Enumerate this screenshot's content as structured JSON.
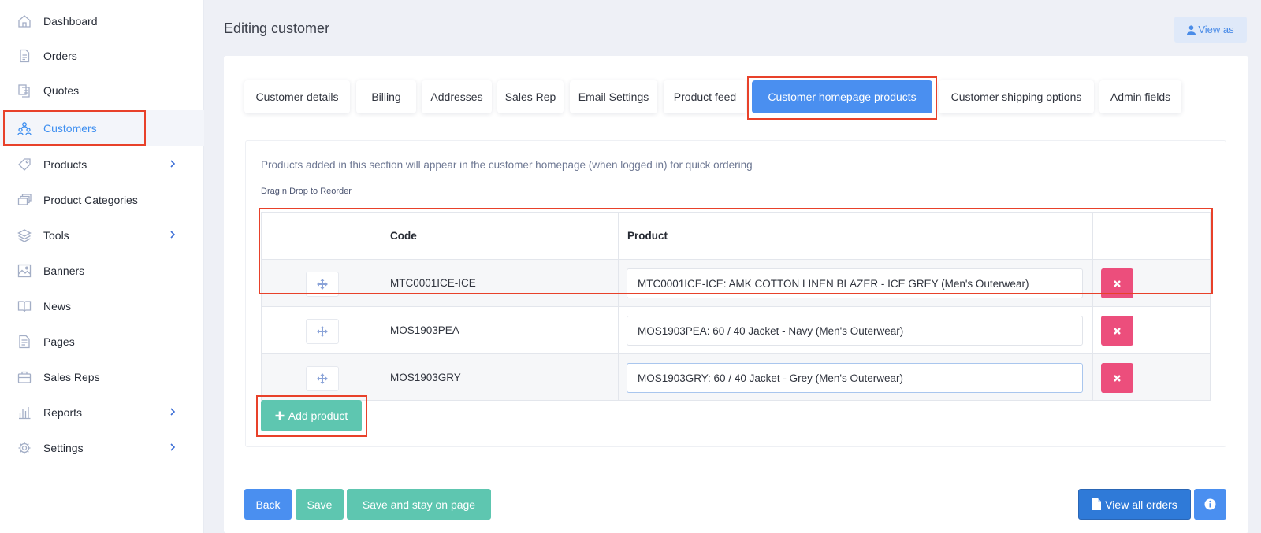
{
  "sidebar": {
    "items": [
      {
        "label": "Dashboard",
        "icon": "home-icon",
        "chevron": false,
        "active": false
      },
      {
        "label": "Orders",
        "icon": "document-icon",
        "chevron": false,
        "active": false
      },
      {
        "label": "Quotes",
        "icon": "quotes-icon",
        "chevron": false,
        "active": false
      },
      {
        "label": "Customers",
        "icon": "users-icon",
        "chevron": false,
        "active": true
      },
      {
        "label": "Products",
        "icon": "tag-icon",
        "chevron": true,
        "active": false
      },
      {
        "label": "Product Categories",
        "icon": "stack-icon",
        "chevron": false,
        "active": false
      },
      {
        "label": "Tools",
        "icon": "layers-icon",
        "chevron": true,
        "active": false
      },
      {
        "label": "Banners",
        "icon": "image-icon",
        "chevron": false,
        "active": false
      },
      {
        "label": "News",
        "icon": "book-icon",
        "chevron": false,
        "active": false
      },
      {
        "label": "Pages",
        "icon": "page-icon",
        "chevron": false,
        "active": false
      },
      {
        "label": "Sales Reps",
        "icon": "briefcase-icon",
        "chevron": false,
        "active": false
      },
      {
        "label": "Reports",
        "icon": "bar-chart-icon",
        "chevron": true,
        "active": false
      },
      {
        "label": "Settings",
        "icon": "gear-icon",
        "chevron": true,
        "active": false
      }
    ]
  },
  "header": {
    "title": "Editing customer",
    "view_as_label": "View as"
  },
  "tabs": [
    {
      "label": "Customer details",
      "active": false
    },
    {
      "label": "Billing",
      "active": false
    },
    {
      "label": "Addresses",
      "active": false
    },
    {
      "label": "Sales Rep",
      "active": false
    },
    {
      "label": "Email Settings",
      "active": false
    },
    {
      "label": "Product feed",
      "active": false
    },
    {
      "label": "Customer homepage products",
      "active": true
    },
    {
      "label": "Customer shipping options",
      "active": false
    },
    {
      "label": "Admin fields",
      "active": false
    }
  ],
  "section": {
    "info": "Products added in this section will appear in the customer homepage (when logged in) for quick ordering",
    "drag_hint": "Drag n Drop to Reorder"
  },
  "table": {
    "headers": {
      "handle": "",
      "code": "Code",
      "product": "Product",
      "actions": ""
    },
    "rows": [
      {
        "code": "MTC0001ICE-ICE",
        "product": "MTC0001ICE-ICE: AMK COTTON LINEN BLAZER - ICE GREY (Men's Outerwear)"
      },
      {
        "code": "MOS1903PEA",
        "product": "MOS1903PEA: 60 / 40 Jacket - Navy (Men's Outerwear)"
      },
      {
        "code": "MOS1903GRY",
        "product": "MOS1903GRY: 60 / 40 Jacket - Grey (Men's Outerwear)"
      }
    ]
  },
  "add_product_label": "Add product",
  "footer": {
    "back_label": "Back",
    "save_label": "Save",
    "save_stay_label": "Save and stay on page",
    "view_orders_label": "View all orders"
  },
  "colors": {
    "primary": "#4a8ff0",
    "teal": "#5ec6b0",
    "danger": "#ec4e7c",
    "highlight": "#e8412a"
  }
}
